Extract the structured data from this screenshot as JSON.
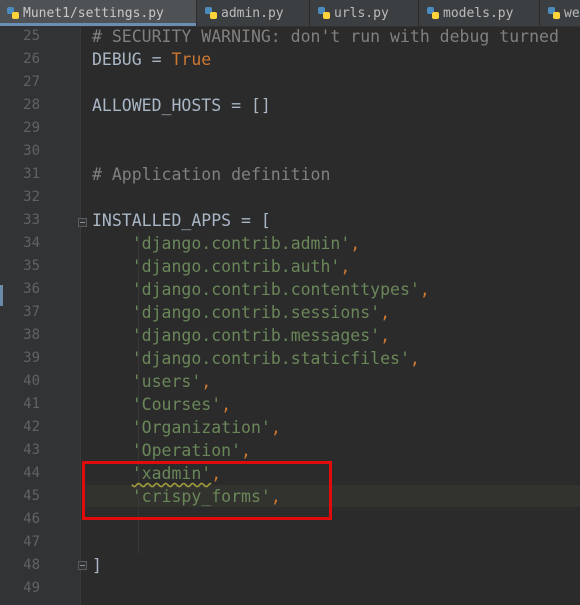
{
  "tabs": [
    {
      "label": "Munet1/settings.py",
      "active": true
    },
    {
      "label": "admin.py",
      "active": false
    },
    {
      "label": "urls.py",
      "active": false
    },
    {
      "label": "models.py",
      "active": false
    },
    {
      "label": "we",
      "active": false
    }
  ],
  "line_numbers": [
    "25",
    "26",
    "27",
    "28",
    "29",
    "30",
    "31",
    "32",
    "33",
    "34",
    "35",
    "36",
    "37",
    "38",
    "39",
    "40",
    "41",
    "42",
    "43",
    "44",
    "45",
    "46",
    "47",
    "48",
    "49"
  ],
  "code": {
    "l25": "# SECURITY WARNING: don't run with debug turned",
    "l26_name": "DEBUG",
    "l26_eq": " = ",
    "l26_val": "True",
    "l28": "ALLOWED_HOSTS = []",
    "l31": "# Application definition",
    "l33": "INSTALLED_APPS = [",
    "apps": [
      {
        "value": "'django.contrib.admin'",
        "sep": ","
      },
      {
        "value": "'django.contrib.auth'",
        "sep": ","
      },
      {
        "value": "'django.contrib.contenttypes'",
        "sep": ","
      },
      {
        "value": "'django.contrib.sessions'",
        "sep": ","
      },
      {
        "value": "'django.contrib.messages'",
        "sep": ","
      },
      {
        "value": "'django.contrib.staticfiles'",
        "sep": ","
      },
      {
        "value": "'users'",
        "sep": ","
      },
      {
        "value": "'Courses'",
        "sep": ","
      },
      {
        "value": "'Organization'",
        "sep": ","
      },
      {
        "value": "'Operation'",
        "sep": ","
      },
      {
        "value": "'xadmin'",
        "sep": ","
      },
      {
        "value": "'crispy_forms'",
        "sep": ","
      }
    ],
    "l48": "]"
  },
  "annotation": {
    "color": "#e00b0b"
  },
  "colors": {
    "keyword": "#cc7832",
    "string": "#6a8759",
    "comment": "#808080",
    "identifier": "#a9b7c6",
    "background": "#2b2b2b"
  }
}
